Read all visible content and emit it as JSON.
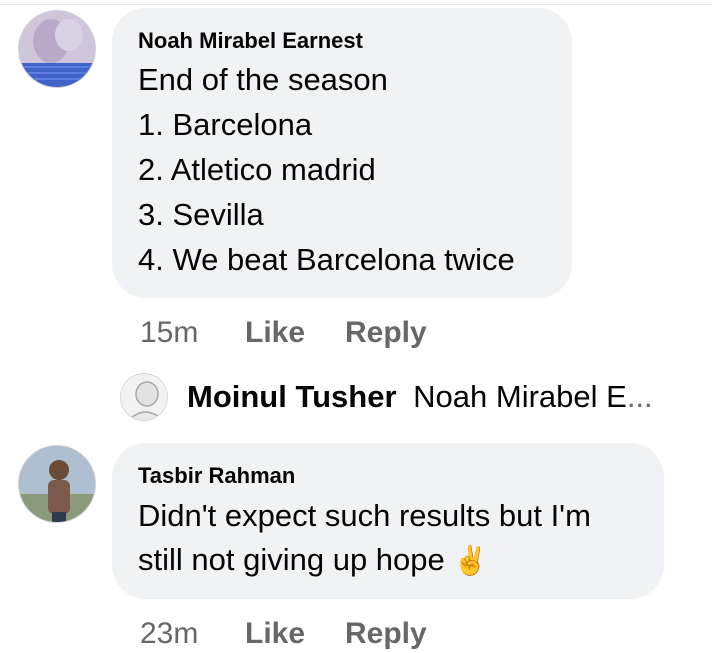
{
  "comments": [
    {
      "author": "Noah Mirabel Earnest",
      "lines": [
        "End of the season",
        "1. Barcelona",
        "2. Atletico madrid",
        "3. Sevilla",
        "4. We beat Barcelona twice"
      ],
      "time": "15m",
      "like_label": "Like",
      "reply_label": "Reply",
      "avatar_icon": "profile-photo-knit-icon"
    },
    {
      "author": "Tasbir Rahman",
      "lines": [
        "Didn't expect such results but I'm",
        "still not giving up hope"
      ],
      "emoji": "✌️",
      "time": "23m",
      "like_label": "Like",
      "reply_label": "Reply",
      "avatar_icon": "profile-photo-person-icon"
    }
  ],
  "reply_preview": {
    "author": "Moinul Tusher",
    "text": "Noah Mirabel E",
    "ellipsis": "...",
    "avatar_icon": "profile-photo-sketch-icon"
  },
  "colors": {
    "bubble": "#f0f2f5",
    "text": "#050505",
    "secondary": "#65676b"
  }
}
